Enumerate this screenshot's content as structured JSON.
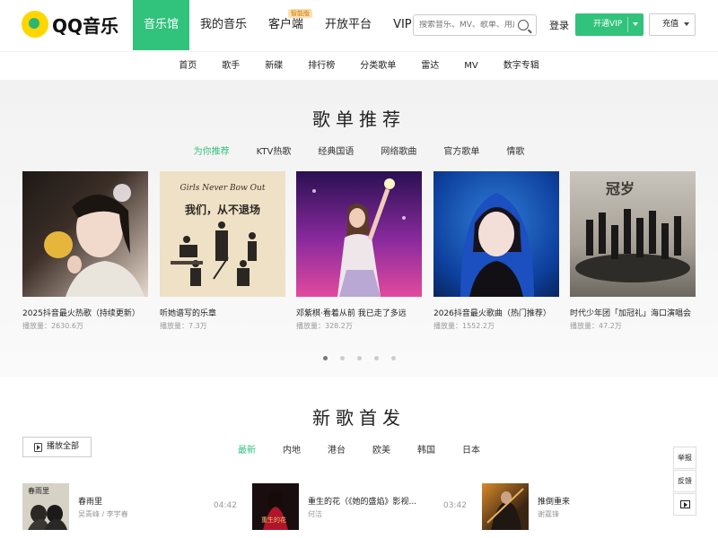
{
  "logo": {
    "text": "QQ音乐"
  },
  "nav": {
    "items": [
      {
        "label": "音乐馆"
      },
      {
        "label": "我的音乐"
      },
      {
        "label": "客户端",
        "badge": "智能版"
      },
      {
        "label": "开放平台"
      },
      {
        "label": "VIP"
      }
    ]
  },
  "search": {
    "placeholder": "搜索音乐、MV、歌单、用户"
  },
  "account": {
    "login_label": "登录",
    "vip_label": "开通VIP",
    "recharge_label": "充值"
  },
  "subnav": {
    "items": [
      "首页",
      "歌手",
      "新碟",
      "排行榜",
      "分类歌单",
      "雷达",
      "MV",
      "数字专辑"
    ]
  },
  "playlists": {
    "title": "歌单推荐",
    "tabs": [
      "为你推荐",
      "KTV热歌",
      "经典国语",
      "网络歌曲",
      "官方歌单",
      "情歌"
    ],
    "cards": [
      {
        "title": "2025抖音最火热歌（持续更新）",
        "plays": "播放量：2630.6万"
      },
      {
        "title": "听她谱写的乐章",
        "plays": "播放量：7.3万"
      },
      {
        "title": "邓紫棋·看着从前 我已走了多远",
        "plays": "播放量：328.2万"
      },
      {
        "title": "2026抖音最火歌曲（热门推荐）",
        "plays": "播放量：1552.2万"
      },
      {
        "title": "时代少年团「加冠礼」海口演唱会",
        "plays": "播放量：47.2万"
      }
    ],
    "cover_texts": {
      "card2_top": "Girls Never Bow Out",
      "card2_main": "我们，从不退场",
      "card5_main": "冠岁"
    },
    "carousel": {
      "count": 5,
      "active_index": 0
    }
  },
  "new_songs": {
    "title": "新歌首发",
    "play_all_label": "播放全部",
    "tabs": [
      "最新",
      "内地",
      "港台",
      "欧美",
      "韩国",
      "日本"
    ],
    "songs": [
      {
        "name": "春雨里",
        "artist": "吴青峰 / 李宇春",
        "time": "04:42"
      },
      {
        "name": "重生的花（《她的盛焰》影视...",
        "artist": "何洁",
        "time": "03:42"
      },
      {
        "name": "推倒重来",
        "artist": "谢霆锋",
        "time": ""
      }
    ],
    "cover_texts": {
      "song1": "春雨里",
      "song2": "重生的花"
    }
  },
  "side_tools": {
    "report_label": "举报",
    "feedback_label": "反馈"
  },
  "colors": {
    "accent": "#31c27c",
    "logo_yellow": "#ffd600"
  }
}
